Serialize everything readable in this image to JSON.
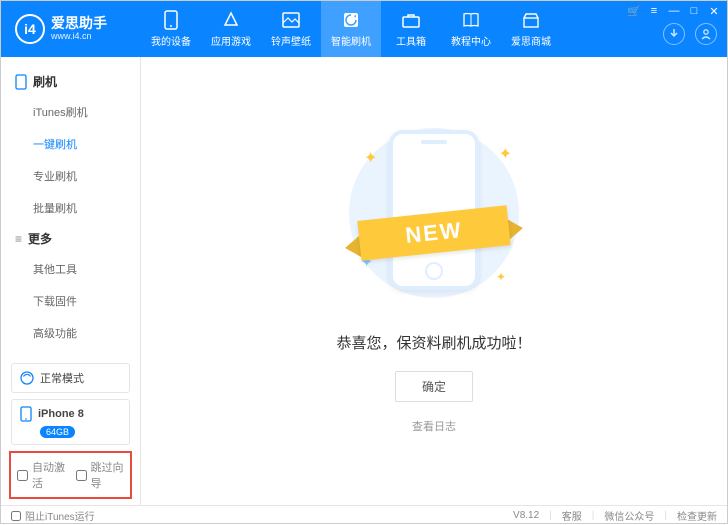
{
  "header": {
    "logo_cn": "爱思助手",
    "logo_en": "www.i4.cn",
    "logo_badge": "i4",
    "nav": [
      {
        "label": "我的设备"
      },
      {
        "label": "应用游戏"
      },
      {
        "label": "铃声壁纸"
      },
      {
        "label": "智能刷机"
      },
      {
        "label": "工具箱"
      },
      {
        "label": "教程中心"
      },
      {
        "label": "爱思商城"
      }
    ]
  },
  "sidebar": {
    "group1": "刷机",
    "items1": [
      "iTunes刷机",
      "一键刷机",
      "专业刷机",
      "批量刷机"
    ],
    "group2": "更多",
    "items2": [
      "其他工具",
      "下载固件",
      "高级功能"
    ],
    "mode": "正常模式",
    "device": "iPhone 8",
    "storage": "64GB",
    "check1": "自动激活",
    "check2": "跳过向导"
  },
  "main": {
    "ribbon": "NEW",
    "success": "恭喜您，保资料刷机成功啦！",
    "ok": "确定",
    "log": "查看日志"
  },
  "footer": {
    "block_itunes": "阻止iTunes运行",
    "version": "V8.12",
    "support": "客服",
    "wechat": "微信公众号",
    "update": "检查更新"
  }
}
